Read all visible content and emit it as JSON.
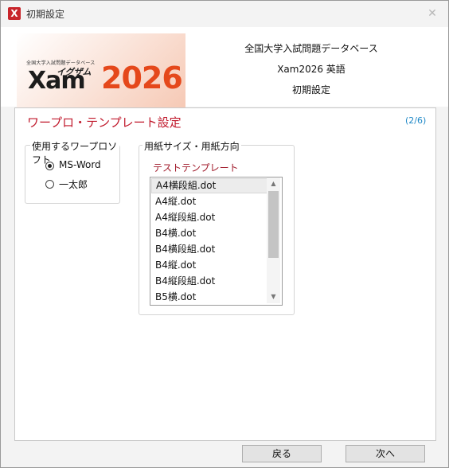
{
  "window": {
    "title": "初期設定",
    "close_glyph": "✕"
  },
  "header": {
    "logo": {
      "small_text": "全国大学入試問題データベース",
      "kana": "イグザム",
      "xam": "Xam",
      "year": "2026"
    },
    "line1": "全国大学入試問題データベース",
    "line2": "Xam2026 英語",
    "line3": "初期設定"
  },
  "panel": {
    "title": "ワープロ・テンプレート設定",
    "step": "(2/6)",
    "software_group": {
      "label": "使用するワープロソフト",
      "options": [
        {
          "label": "MS-Word",
          "selected": true
        },
        {
          "label": "一太郎",
          "selected": false
        }
      ]
    },
    "paper_group": {
      "label": "用紙サイズ・用紙方向",
      "template_label": "テストテンプレート",
      "items": [
        "A4横段組.dot",
        "A4縦.dot",
        "A4縦段組.dot",
        "B4横.dot",
        "B4横段組.dot",
        "B4縦.dot",
        "B4縦段組.dot",
        "B5横.dot"
      ],
      "selected_index": 0
    }
  },
  "buttons": {
    "back": "戻る",
    "next": "次へ"
  }
}
